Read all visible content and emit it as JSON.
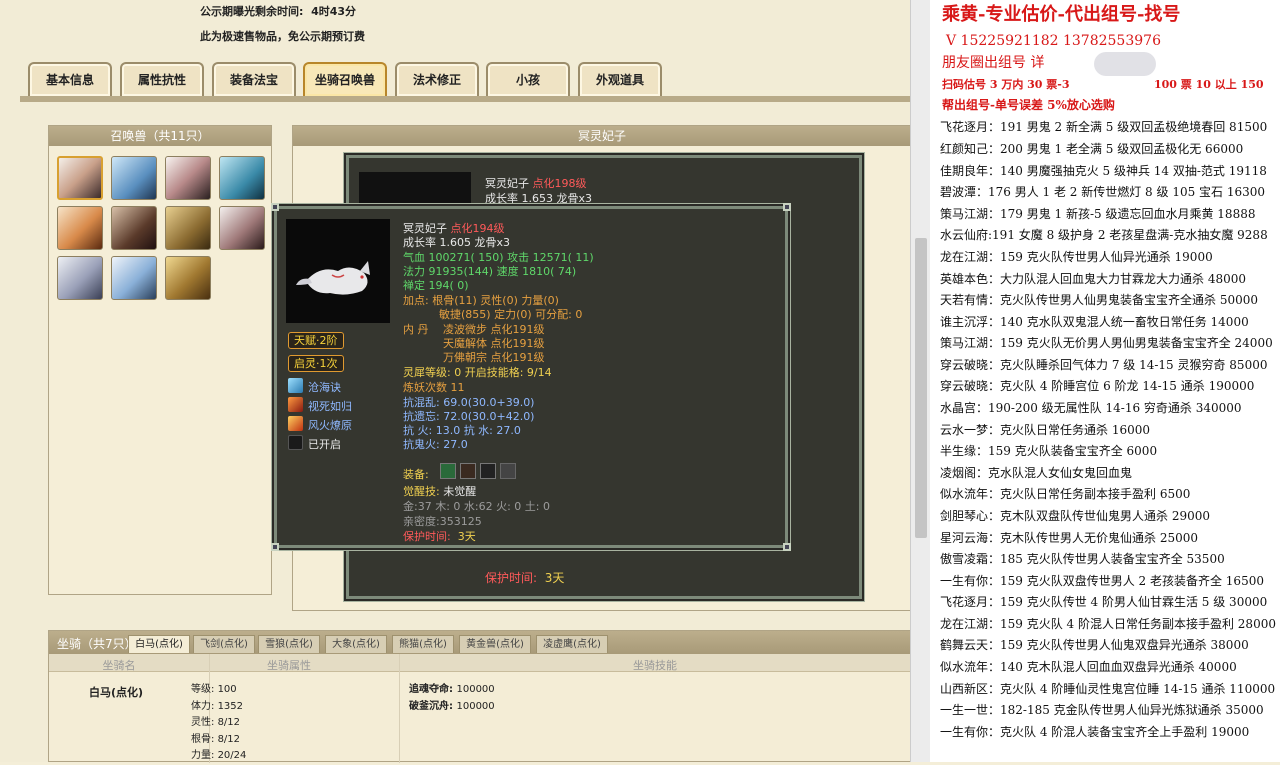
{
  "header": {
    "countdown_label": "公示期曝光剩余时间:",
    "countdown_value": "4时43分",
    "notice": "此为极速售物品，免公示期预订费"
  },
  "tabs": [
    "基本信息",
    "属性抗性",
    "装备法宝",
    "坐骑召唤兽",
    "法术修正",
    "小孩",
    "外观道具"
  ],
  "summon_panel": {
    "title": "召唤兽（共11只）"
  },
  "pet_detail_panel": {
    "title": "冥灵妃子"
  },
  "back_card": {
    "name": "冥灵妃子",
    "level": "点化198级",
    "growth": "成长率 1.653 龙骨x3",
    "protect_label": "保护时间:",
    "protect_value": "3天"
  },
  "front_card": {
    "name": "冥灵妃子",
    "level": "点化194级",
    "growth": "成长率 1.605 龙骨x3",
    "hp_label": "气血",
    "hp_value": "100271( 150)",
    "atk_label": "攻击",
    "atk_value": "12571( 11)",
    "mp_label": "法力",
    "mp_value": "91935(144)",
    "spd_label": "速度",
    "spd_value": "1810( 74)",
    "zen": "禅定 194( 0)",
    "points_1": "加点: 根骨(11) 灵性(0) 力量(0)",
    "points_2": "敏捷(855) 定力(0) 可分配: 0",
    "neidan_label": "内    丹",
    "neidan_1": "凌波微步 点化191级",
    "neidan_2": "天魔解体 点化191级",
    "neidan_3": "万佛朝宗 点化191级",
    "spirit_level_label": "灵犀等级:",
    "spirit_level_value": "0 开启技能格: 9/14",
    "refine": "炼妖次数 11",
    "res_1": "抗混乱: 69.0(30.0+39.0)",
    "res_2": "抗遗忘: 72.0(30.0+42.0)",
    "res_3": "抗    火: 13.0 抗    水: 27.0",
    "res_4": "抗鬼火: 27.0",
    "equip_label": "装备:",
    "awaken_label": "觉醒技:",
    "awaken_value": "未觉醒",
    "elements": "金:37 木: 0 水:62 火: 0 土: 0",
    "intimacy": "亲密度:353125",
    "protect_label": "保护时间:",
    "protect_value": "3天",
    "badge_talent": "天赋·2阶",
    "badge_spirit": "启灵·1次",
    "skills": [
      {
        "name": "沧海诀",
        "icon": "wave-icon"
      },
      {
        "name": "视死如归",
        "icon": "flame-icon"
      },
      {
        "name": "风火燎原",
        "icon": "fire-icon"
      },
      {
        "name": "已开启",
        "icon": "slot-icon"
      }
    ]
  },
  "mounts": {
    "title": "坐骑（共7只）",
    "tabs": [
      "白马(点化)",
      "飞剑(点化)",
      "雪狼(点化)",
      "大象(点化)",
      "熊猫(点化)",
      "黄金兽(点化)",
      "凌虚鹰(点化)"
    ],
    "col_name": "坐骑名",
    "col_attr": "坐骑属性",
    "col_skill": "坐骑技能",
    "name": "白马(点化)",
    "attrs": [
      {
        "k": "等级:",
        "v": "100"
      },
      {
        "k": "体力:",
        "v": "1352"
      },
      {
        "k": "灵性:",
        "v": "8/12"
      },
      {
        "k": "根骨:",
        "v": "8/12"
      },
      {
        "k": "力量:",
        "v": "20/24"
      }
    ],
    "skills": [
      {
        "k": "追魂夺命:",
        "v": "100000"
      },
      {
        "k": "破釜沉舟:",
        "v": "100000"
      }
    ]
  },
  "ad": {
    "title": "乘黄-专业估价-代出组号-找号",
    "phone": "V 15225921182   13782553976",
    "line3": "朋友圈出组号    详",
    "line4": "扫码估号 3 万内 30 票-3",
    "line4b": "100 票 10 以上 150",
    "line5": "帮出组号-单号误差 5%放心选购",
    "entries": [
      "飞花逐月：191 男鬼 2 新全满 5 级双回孟极绝境春回 81500",
      "红颜知己：200 男鬼 1 老全满 5 级双回孟极化无 66000",
      "佳期良年：140 男魔强抽克火 5 级神兵 14 双抽-范式 19118",
      "碧波潭：176 男人 1 老 2 新传世燃灯 8 级 105 宝石 16300",
      "策马江湖：179 男鬼 1 新孩-5 级遗忘回血水月乘黄 18888",
      "水云仙府:191 女魔 8 级护身 2 老孩星盘满-克水抽女魔 9288",
      "龙在江湖：159 克火队传世男人仙异光通杀 19000",
      "英雄本色：大力队混人回血鬼大力甘霖龙大力通杀 48000",
      "天若有情：克火队传世男人仙男鬼装备宝宝齐全通杀 50000",
      "谁主沉浮：140 克水队双鬼混人统一畜牧日常任务 14000",
      "策马江湖：159 克火队无价男人男仙男鬼装备宝宝齐全 24000",
      "穿云破晓：克火队睡杀回气体力 7 级 14-15 灵猴穷奇 85000",
      "穿云破晓：克火队 4 阶睡宫位 6 阶龙 14-15 通杀 190000",
      "水晶宫：190-200 级无属性队 14-16 穷奇通杀 340000",
      "云水一梦：克火队日常任务通杀 16000",
      "半生缘：159 克火队装备宝宝齐全 6000",
      "凌烟阁：克水队混人女仙女鬼回血鬼",
      "似水流年：克火队日常任务副本接手盈利 6500",
      "剑胆琴心：克木队双盘队传世仙鬼男人通杀 29000",
      "星河云海：克木队传世男人无价鬼仙通杀 25000",
      "傲雪凌霜：185 克火队传世男人装备宝宝齐全 53500",
      "一生有你：159 克火队双盘传世男人 2 老孩装备齐全 16500",
      "飞花逐月：159 克火队传世 4 阶男人仙甘霖生活 5 级 30000",
      "龙在江湖：159 克火队 4 阶混人日常任务副本接手盈利 28000",
      "鹤舞云天：159 克火队传世男人仙鬼双盘异光通杀 38000",
      "似水流年：140 克木队混人回血血双盘异光通杀 40000",
      "山西新区：克火队 4 阶睡仙灵性鬼宫位睡 14-15 通杀 110000",
      "一生一世：182-185 克金队传世男人仙异光炼狱通杀 35000",
      "一生有你：克火队 4 阶混人装备宝宝齐全上手盈利 19000"
    ]
  },
  "colors": {
    "accent": "#d81818",
    "gold": "#f0d050",
    "panel": "#35362f"
  }
}
